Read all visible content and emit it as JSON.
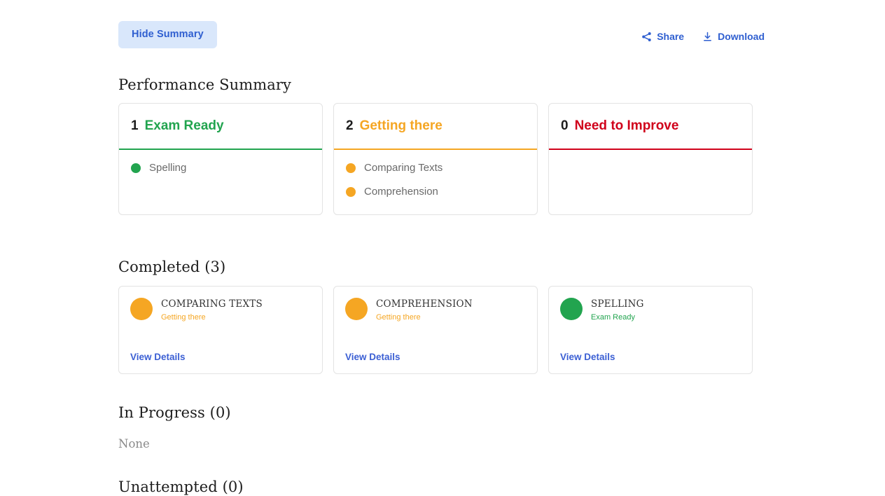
{
  "colors": {
    "green": "#22a44f",
    "orange": "#f5a623",
    "red": "#d0021b",
    "blue": "#2f5fd0",
    "link_blue": "#3b5fd4",
    "button_bg": "#d9e7fb"
  },
  "toolbar": {
    "hide_summary_label": "Hide Summary",
    "share_label": "Share",
    "share_icon": "share-icon",
    "download_label": "Download",
    "download_icon": "download-icon"
  },
  "performance_summary": {
    "heading": "Performance Summary",
    "cards": [
      {
        "count": "1",
        "label": "Exam Ready",
        "color": "#22a44f",
        "subjects": [
          {
            "name": "Spelling",
            "color": "#22a44f"
          }
        ]
      },
      {
        "count": "2",
        "label": "Getting there",
        "color": "#f5a623",
        "subjects": [
          {
            "name": "Comparing Texts",
            "color": "#f5a623"
          },
          {
            "name": "Comprehension",
            "color": "#f5a623"
          }
        ]
      },
      {
        "count": "0",
        "label": "Need to Improve",
        "color": "#d0021b",
        "subjects": []
      }
    ]
  },
  "completed": {
    "heading": "Completed (3)",
    "cards": [
      {
        "title": "COMPARING TEXTS",
        "status": "Getting there",
        "color": "#f5a623",
        "link_label": "View Details"
      },
      {
        "title": "COMPREHENSION",
        "status": "Getting there",
        "color": "#f5a623",
        "link_label": "View Details"
      },
      {
        "title": "SPELLING",
        "status": "Exam Ready",
        "color": "#22a44f",
        "link_label": "View Details"
      }
    ]
  },
  "in_progress": {
    "heading": "In Progress (0)",
    "empty_text": "None"
  },
  "unattempted": {
    "heading": "Unattempted (0)"
  }
}
